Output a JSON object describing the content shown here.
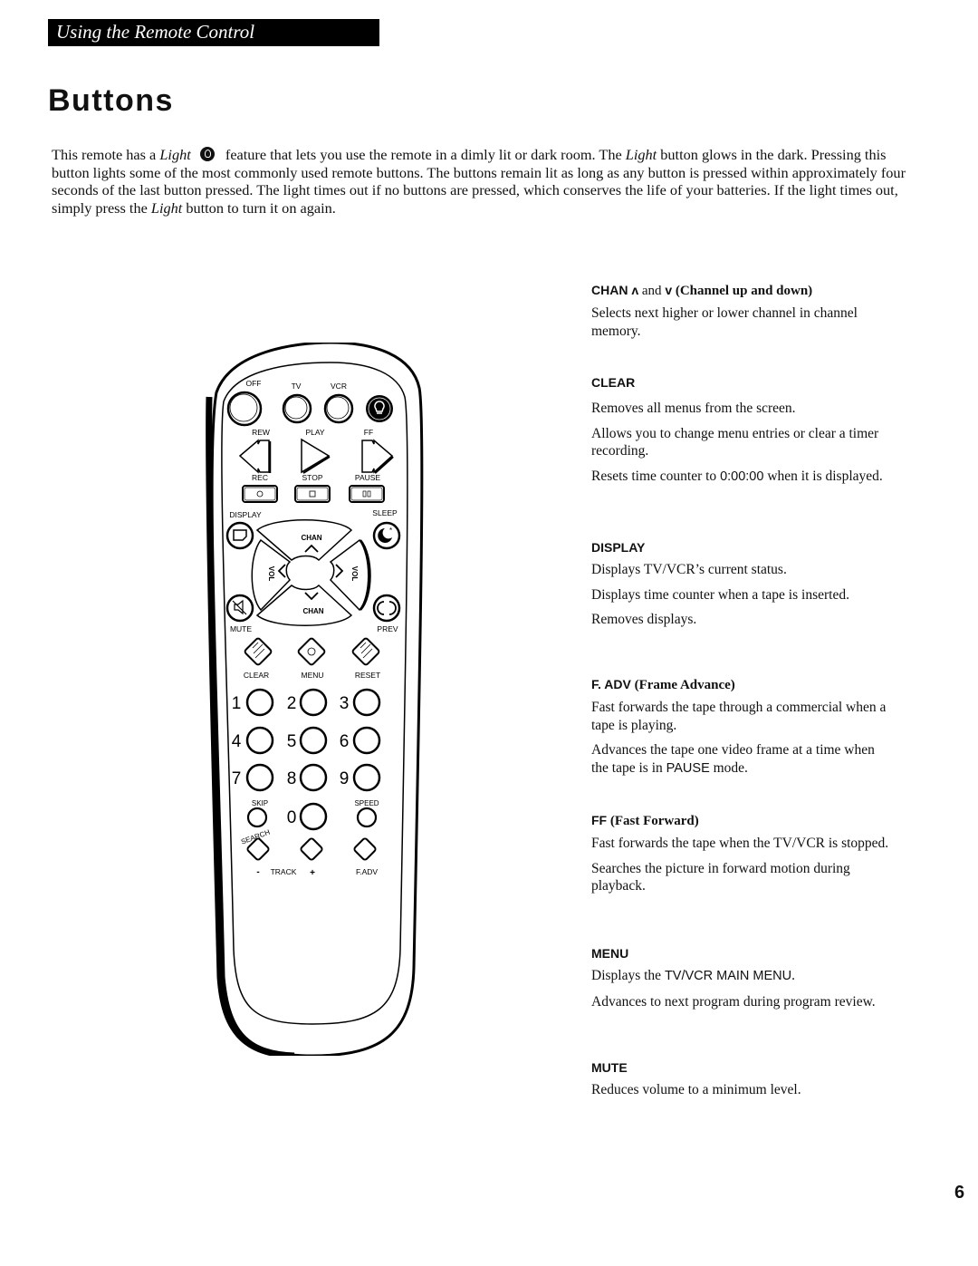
{
  "header": {
    "section_label": "Using the Remote Control",
    "title": "Buttons"
  },
  "intro": {
    "part1": "This remote has a ",
    "light_word": "Light",
    "light_icon": "lightbulb-icon",
    "part2": " feature that lets you use the remote in a dimly lit or dark room. The ",
    "light_word2": "Light",
    "part3": " button glows in the dark. Pressing this button lights some of the most commonly used remote buttons. The buttons remain lit as long as any button is pressed within approximately four seconds of the last button pressed. The light times out if no buttons are pressed, which conserves the life of your batteries. If the light times out, simply press the ",
    "light_word3": "Light",
    "part4": " button to turn it on again."
  },
  "remote": {
    "row1": {
      "off": "OFF",
      "tv": "TV",
      "vcr": "VCR",
      "light_icon": "lightbulb-icon"
    },
    "row2": {
      "rew": "REW",
      "play": "PLAY",
      "ff": "FF"
    },
    "row3": {
      "rec": "REC",
      "stop": "STOP",
      "pause": "PAUSE"
    },
    "display": "DISPLAY",
    "sleep": "SLEEP",
    "chan": "CHAN",
    "vol": "VOL",
    "mute": "MUTE",
    "prev": "PREV",
    "clear": "CLEAR",
    "menu": "MENU",
    "reset": "RESET",
    "digits": [
      "1",
      "2",
      "3",
      "4",
      "5",
      "6",
      "7",
      "8",
      "9",
      "0"
    ],
    "skip": "SKIP",
    "search": "SEARCH",
    "speed": "SPEED",
    "track_minus": "-",
    "track": "TRACK",
    "track_plus": "+",
    "fadv": "F.ADV"
  },
  "descriptions": {
    "chan": {
      "title_a": "CHAN ",
      "up_glyph": "ʌ",
      "and": " and ",
      "down_glyph": "v",
      "title_b": " (Channel up and down)",
      "lines": [
        "Selects next higher or lower channel in channel memory."
      ]
    },
    "clear": {
      "title": "CLEAR",
      "lines": [
        "Removes all menus from the screen.",
        "Allows you to change menu entries or clear a timer recording.",
        "Resets time counter to ",
        "0:00:00",
        " when it is displayed."
      ]
    },
    "display": {
      "title": "DISPLAY",
      "lines": [
        "Displays TV/VCR’s current status.",
        "Displays time counter when a tape is inserted.",
        "Removes displays."
      ]
    },
    "fadv": {
      "title_a": "F. ADV",
      "title_b": " (Frame Advance)",
      "lines": [
        "Fast forwards the tape through a commercial when a tape is playing.",
        "Advances the tape one video frame at a time when the tape is in ",
        "PAUSE",
        " mode."
      ]
    },
    "ff": {
      "title_a": "FF",
      "title_b": " (Fast Forward)",
      "lines": [
        "Fast forwards the tape when the TV/VCR is stopped.",
        "Searches the picture in forward motion during playback."
      ]
    },
    "menu": {
      "title": "MENU",
      "lines": [
        "Displays the ",
        "TV/VCR MAIN MENU",
        ".",
        "Advances to next program during program review."
      ]
    },
    "mute": {
      "title": "MUTE",
      "lines": [
        "Reduces volume to a minimum level."
      ]
    }
  },
  "footer": {
    "page_number": "6"
  }
}
